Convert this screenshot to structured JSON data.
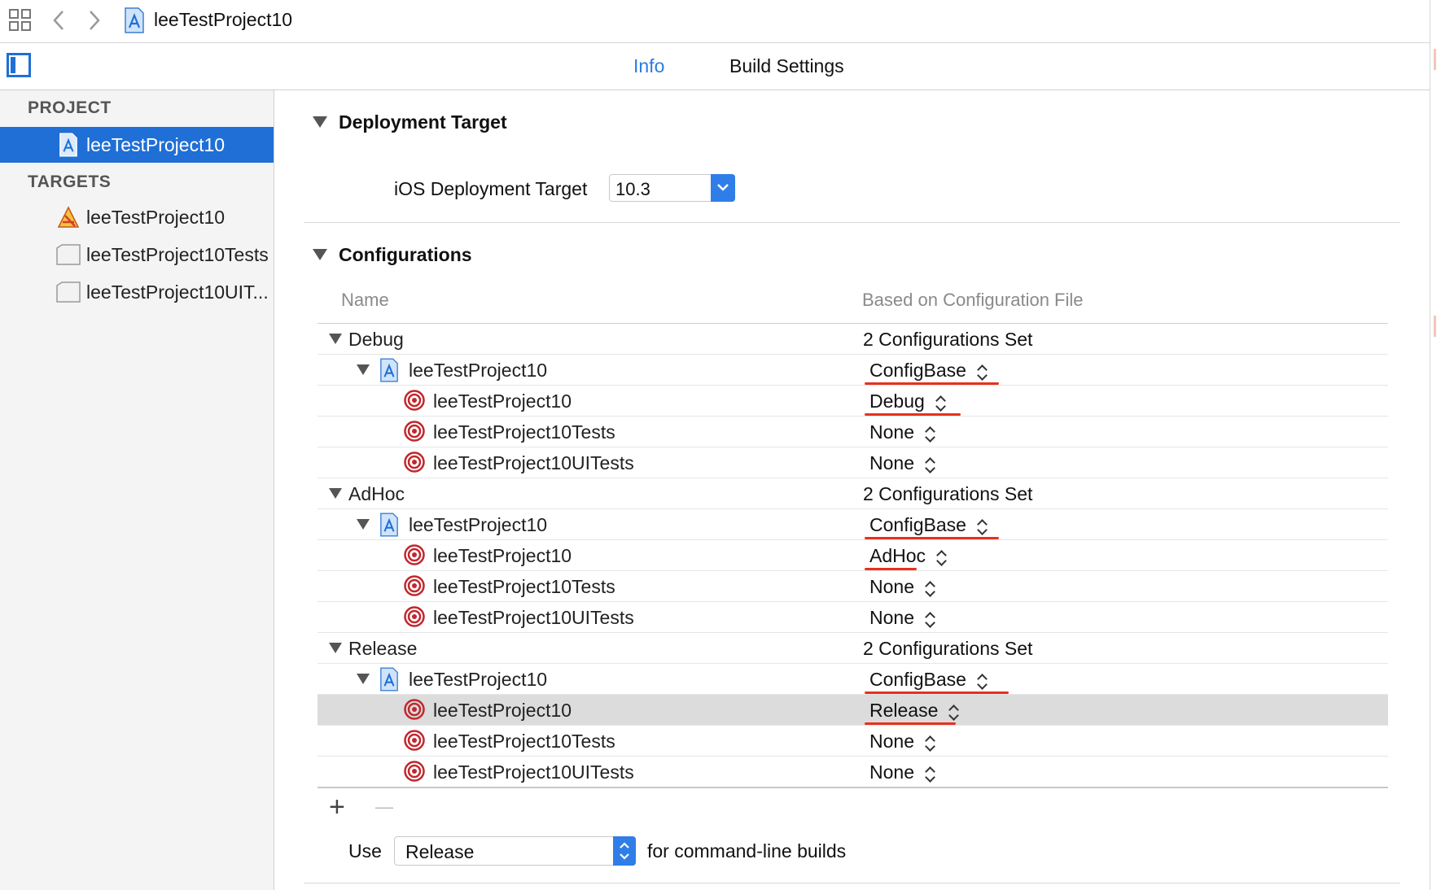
{
  "toolbar": {
    "breadcrumb_project": "leeTestProject10"
  },
  "tabs": {
    "info": "Info",
    "build_settings": "Build Settings",
    "active": "info"
  },
  "sidebar": {
    "project_header": "PROJECT",
    "project_item": "leeTestProject10",
    "targets_header": "TARGETS",
    "targets": [
      "leeTestProject10",
      "leeTestProject10Tests",
      "leeTestProject10UIT..."
    ]
  },
  "deployment": {
    "title": "Deployment Target",
    "label": "iOS Deployment Target",
    "value": "10.3"
  },
  "configurations": {
    "title": "Configurations",
    "col_name": "Name",
    "col_based_on": "Based on Configuration File",
    "groups": [
      {
        "name": "Debug",
        "summary": "2 Configurations Set",
        "project": "leeTestProject10",
        "project_config": "ConfigBase",
        "targets": [
          {
            "name": "leeTestProject10",
            "config": "Debug"
          },
          {
            "name": "leeTestProject10Tests",
            "config": "None"
          },
          {
            "name": "leeTestProject10UITests",
            "config": "None"
          }
        ]
      },
      {
        "name": "AdHoc",
        "summary": "2 Configurations Set",
        "project": "leeTestProject10",
        "project_config": "ConfigBase",
        "targets": [
          {
            "name": "leeTestProject10",
            "config": "AdHoc"
          },
          {
            "name": "leeTestProject10Tests",
            "config": "None"
          },
          {
            "name": "leeTestProject10UITests",
            "config": "None"
          }
        ]
      },
      {
        "name": "Release",
        "summary": "2 Configurations Set",
        "project": "leeTestProject10",
        "project_config": "ConfigBase",
        "targets": [
          {
            "name": "leeTestProject10",
            "config": "Release"
          },
          {
            "name": "leeTestProject10Tests",
            "config": "None"
          },
          {
            "name": "leeTestProject10UITests",
            "config": "None"
          }
        ]
      }
    ],
    "add_symbol": "+",
    "remove_symbol": "—"
  },
  "cmdline": {
    "use_label": "Use",
    "value": "Release",
    "suffix": "for command-line builds"
  },
  "colors": {
    "accent": "#1f6fd6",
    "annotation": "#e8301c",
    "target_icon": "#c0282d"
  },
  "icons": [
    "grid-icon",
    "back-chevron-icon",
    "forward-chevron-icon",
    "project-file-icon",
    "sidebar-toggle-icon",
    "app-target-icon",
    "test-target-icon",
    "target-icon",
    "stepper-icon",
    "popup-chevron-icon"
  ]
}
